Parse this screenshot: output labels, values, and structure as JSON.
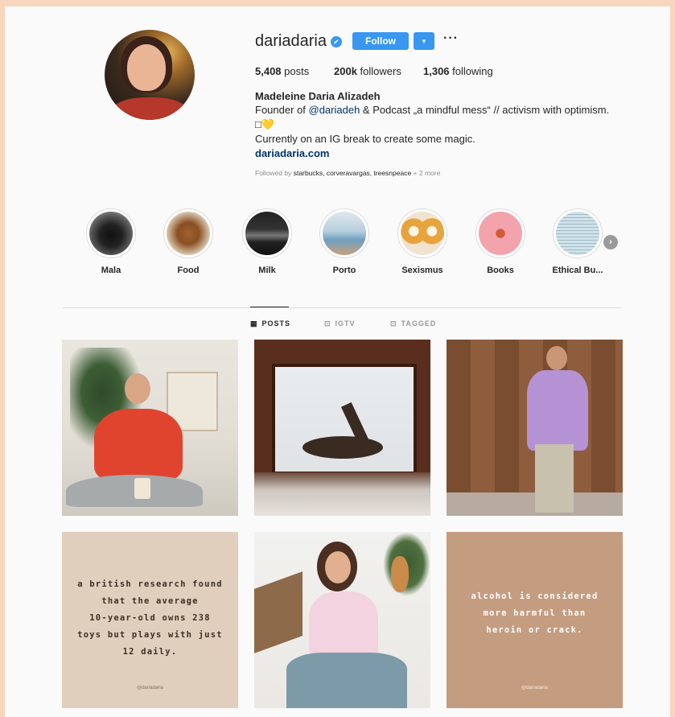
{
  "profile": {
    "username": "dariadaria",
    "verified_icon": "✔",
    "follow_label": "Follow",
    "dropdown_icon": "▾",
    "more_icon": "···",
    "posts_count": "5,408",
    "posts_label": "posts",
    "followers_count": "200k",
    "followers_label": "followers",
    "following_count": "1,306",
    "following_label": "following",
    "full_name": "Madeleine Daria Alizadeh",
    "bio_line1_a": "Founder of ",
    "bio_line1_mention": "@dariadeh",
    "bio_line1_b": " & Podcast „a mindful mess“ // activism with optimism.",
    "bio_line2": "□💛",
    "bio_line3": "Currently on an IG break to create some magic.",
    "website": "dariadaria.com",
    "followed_by_label": "Followed by ",
    "followed_by_names": "starbucks, corveravargas, treesnpeace",
    "followed_by_more": " + 2 more"
  },
  "highlights": [
    {
      "label": "Mala"
    },
    {
      "label": "Food"
    },
    {
      "label": "Milk"
    },
    {
      "label": "Porto"
    },
    {
      "label": "Sexismus"
    },
    {
      "label": "Books"
    },
    {
      "label": "Ethical Bu..."
    }
  ],
  "highlights_next_icon": "›",
  "tabs": {
    "posts": {
      "label": "POSTS",
      "icon": "▦"
    },
    "igtv": {
      "label": "IGTV",
      "icon": "⊡"
    },
    "tagged": {
      "label": "TAGGED",
      "icon": "⊡"
    }
  },
  "posts": {
    "quote1": [
      "a british research found",
      "that the average",
      "10-year-old owns 238",
      "toys but plays with just",
      "12 daily."
    ],
    "quote2": [
      "alcohol is considered",
      "more harmful than",
      "heroin or crack."
    ],
    "credit": "@dariadaria"
  },
  "colors": {
    "accent": "#3897f0",
    "border": "#f8d5bd",
    "quote1_bg": "#e0cfbd",
    "quote2_bg": "#c49c80"
  }
}
